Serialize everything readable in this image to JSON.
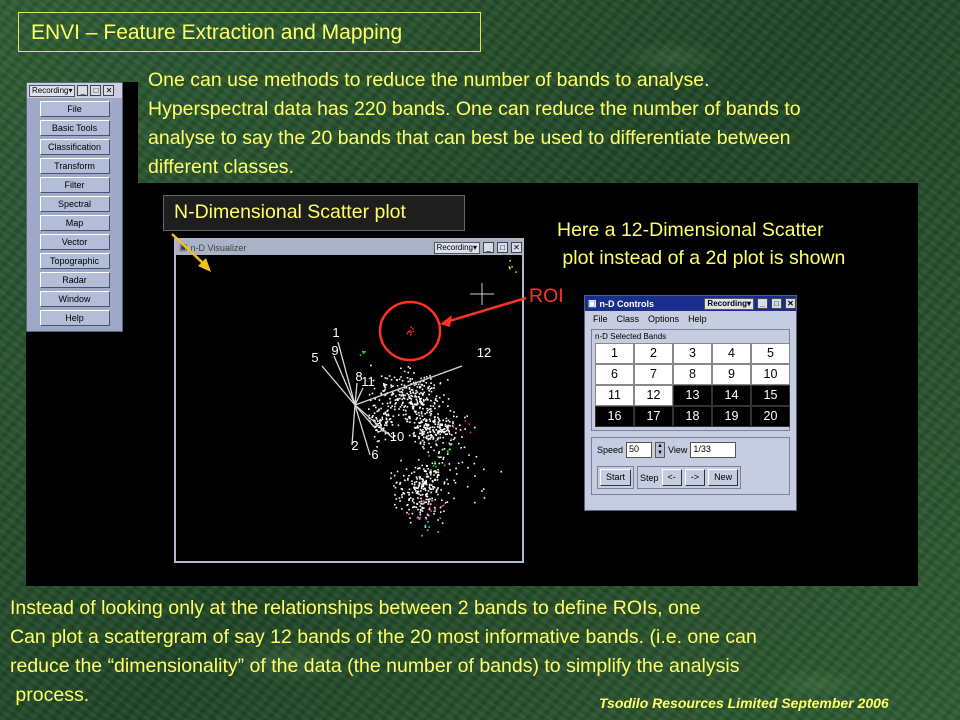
{
  "slide": {
    "title": "ENVI – Feature Extraction and Mapping",
    "intro_lines": [
      "One can use methods to reduce the number of bands to analyse.",
      "Hyperspectral data has 220 bands. One can reduce the number of bands to",
      "analyse to say the 20 bands that can best be used to differentiate between",
      "different classes."
    ],
    "scatter_label": "N-Dimensional Scatter plot",
    "here_lines": [
      "Here a 12-Dimensional Scatter",
      " plot instead of a 2d plot is shown"
    ],
    "roi_label": "ROI",
    "outro_lines": [
      "Instead of looking only at the relationships between 2 bands to define ROIs, one",
      "Can plot a scattergram of say 12 bands of the 20 most informative bands. (i.e. one can",
      "reduce the “dimensionality” of the data (the number of bands) to simplify the analysis",
      " process."
    ],
    "footer": "Tsodilo Resources Limited September 2006"
  },
  "envi_menu": {
    "recording": "Recording▾",
    "items": [
      "File",
      "Basic Tools",
      "Classification",
      "Transform",
      "Filter",
      "Spectral",
      "Map",
      "Vector",
      "Topographic",
      "Radar",
      "Window",
      "Help"
    ]
  },
  "visualizer": {
    "title": "n-D Visualizer",
    "recording": "Recording▾",
    "axis_labels": [
      "1",
      "9",
      "5",
      "8",
      "11",
      "3",
      "10",
      "2",
      "6",
      "12"
    ]
  },
  "nd_controls": {
    "title": "n-D Controls",
    "recording": "Recording▾",
    "menu": [
      "File",
      "Class",
      "Options",
      "Help"
    ],
    "bands_label": "n-D Selected Bands",
    "bands": [
      {
        "n": "1",
        "selected": true
      },
      {
        "n": "2",
        "selected": true
      },
      {
        "n": "3",
        "selected": true
      },
      {
        "n": "4",
        "selected": true
      },
      {
        "n": "5",
        "selected": true
      },
      {
        "n": "6",
        "selected": true
      },
      {
        "n": "7",
        "selected": true
      },
      {
        "n": "8",
        "selected": true
      },
      {
        "n": "9",
        "selected": true
      },
      {
        "n": "10",
        "selected": true
      },
      {
        "n": "11",
        "selected": true
      },
      {
        "n": "12",
        "selected": true
      },
      {
        "n": "13",
        "selected": false
      },
      {
        "n": "14",
        "selected": false
      },
      {
        "n": "15",
        "selected": false
      },
      {
        "n": "16",
        "selected": false
      },
      {
        "n": "17",
        "selected": false
      },
      {
        "n": "18",
        "selected": false
      },
      {
        "n": "19",
        "selected": false
      },
      {
        "n": "20",
        "selected": false
      }
    ],
    "speed_label": "Speed",
    "speed_value": "50",
    "view_label": "View",
    "view_value": "1/33",
    "start_label": "Start",
    "step_label": "Step",
    "step_back": "<-",
    "step_fwd": "->",
    "new_label": "New"
  },
  "colors": {
    "text": "#ffff66",
    "roi": "#ff3322",
    "arrow": "#f0c020"
  }
}
